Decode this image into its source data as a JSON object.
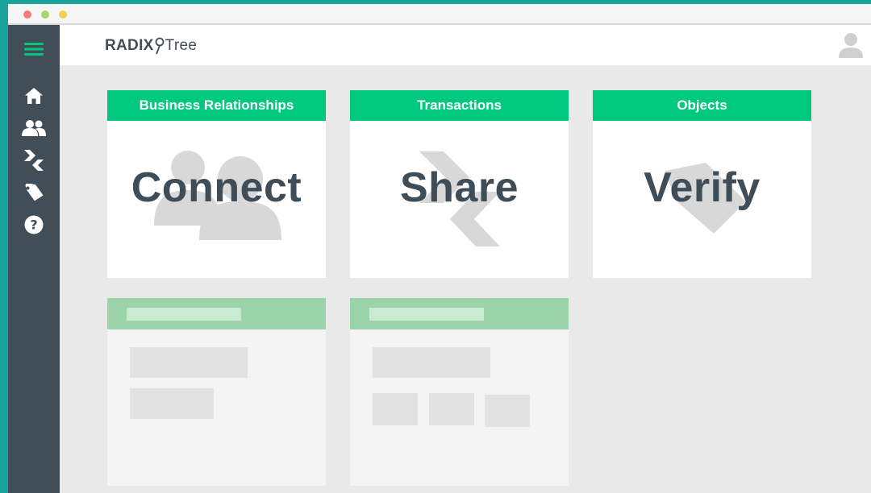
{
  "window": {
    "controls": [
      "close",
      "minimize",
      "maximize"
    ]
  },
  "sidebar": {
    "menu_icon": "hamburger-menu-icon",
    "items": [
      {
        "name": "home",
        "icon": "home-icon"
      },
      {
        "name": "business-relationships",
        "icon": "users-icon"
      },
      {
        "name": "transactions",
        "icon": "transactions-chevrons-icon"
      },
      {
        "name": "objects",
        "icon": "tag-icon"
      },
      {
        "name": "help",
        "icon": "help-circle-icon"
      }
    ]
  },
  "header": {
    "logo_left": "RADIX",
    "logo_right": "Tree",
    "user_icon": "user-avatar-icon"
  },
  "cards": [
    {
      "title": "Business Relationships",
      "word": "Connect",
      "background_icon": "users-icon"
    },
    {
      "title": "Transactions",
      "word": "Share",
      "background_icon": "transactions-chevrons-icon"
    },
    {
      "title": "Objects",
      "word": "Verify",
      "background_icon": "tag-icon"
    }
  ],
  "placeholder_cards": [
    {
      "blocks": 2
    },
    {
      "blocks": 4
    }
  ],
  "colors": {
    "frame": "#1aa39a",
    "sidebar": "#414e58",
    "accent_green": "#00c97f",
    "placeholder_green": "#9bd4a8",
    "canvas": "#e9e9e9"
  }
}
